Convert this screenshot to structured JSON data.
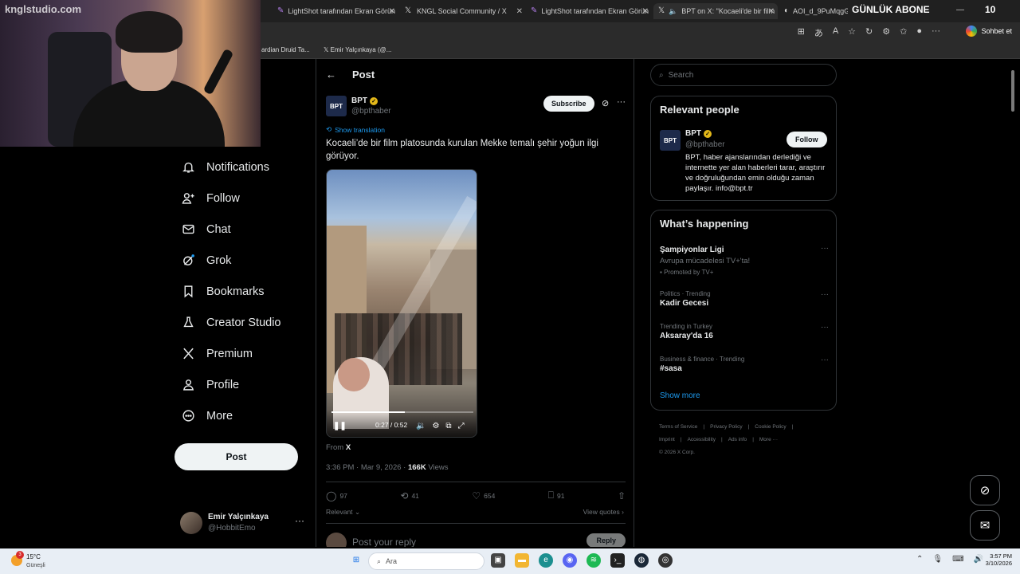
{
  "browser": {
    "tabs": [
      {
        "label": "LightShot tarafından Ekran Görün",
        "icon": "feather-icon"
      },
      {
        "label": "KNGL Social Community / X",
        "icon": "x-logo-icon"
      },
      {
        "label": "LightShot tarafından Ekran Görün",
        "icon": "feather-icon"
      },
      {
        "label": "BPT on X: \"Kocaeli'de bir film",
        "icon": "x-logo-icon",
        "active": true
      },
      {
        "label": "AOI_d_9PuMqgGU",
        "icon": "generic-icon"
      }
    ],
    "sohbet": "Sohbet et",
    "bookmarks": [
      "ardian Druid Ta...",
      "Emir Yalçınkaya (@..."
    ]
  },
  "overlay": {
    "watermark": "knglstudio.com",
    "abone_label": "GÜNLÜK ABONE",
    "abone_count": "10"
  },
  "sidebar": {
    "items": [
      {
        "label": "Notifications",
        "icon": "bell-icon"
      },
      {
        "label": "Follow",
        "icon": "follow-icon"
      },
      {
        "label": "Chat",
        "icon": "mail-icon"
      },
      {
        "label": "Grok",
        "icon": "grok-icon"
      },
      {
        "label": "Bookmarks",
        "icon": "bookmark-icon"
      },
      {
        "label": "Creator Studio",
        "icon": "flask-icon"
      },
      {
        "label": "Premium",
        "icon": "x-logo-icon"
      },
      {
        "label": "Profile",
        "icon": "person-icon"
      },
      {
        "label": "More",
        "icon": "more-circle-icon"
      }
    ],
    "post_label": "Post",
    "account_name": "Emir Yalçınkaya",
    "account_handle": "@HobbitEmo"
  },
  "post": {
    "header": "Post",
    "author_name": "BPT",
    "author_handle": "@bpthaber",
    "author_avatar_text": "BPT",
    "subscribe_label": "Subscribe",
    "show_translation": "Show translation",
    "text": "Kocaeli’de bir film platosunda kurulan Mekke temalı şehir yoğun ilgi görüyor.",
    "video": {
      "current": "0:27",
      "duration": "0:52",
      "time_text": "0:27 / 0:52",
      "progress": 0.519
    },
    "from_label": "From",
    "from_source": "X",
    "timestamp": "3:36 PM · Mar 9, 2026 ·",
    "views_count": "166K",
    "views_label": "Views",
    "stats": {
      "replies": "97",
      "reposts": "41",
      "likes": "654",
      "bookmarks": "91"
    },
    "relevant_label": "Relevant",
    "view_quotes": "View quotes",
    "reply_placeholder": "Post your reply",
    "reply_button": "Reply"
  },
  "right": {
    "search_placeholder": "Search",
    "relevant_title": "Relevant people",
    "person": {
      "name": "BPT",
      "handle": "@bpthaber",
      "avatar_text": "BPT",
      "follow_label": "Follow",
      "bio": "BPT, haber ajanslarından derlediği ve internette yer alan haberleri tarar, araştırır ve doğruluğundan emin olduğu zaman paylaşır. info@bpt.tr"
    },
    "happening_title": "What’s happening",
    "trends": [
      {
        "context": "",
        "title": "Şampiyonlar Ligi",
        "subtitle": "Avrupa mücadelesi TV+'ta!",
        "promo": "Promoted by TV+"
      },
      {
        "context": "Politics · Trending",
        "title": "Kadir Gecesi"
      },
      {
        "context": "Trending in Turkey",
        "title": "Aksaray'da 16"
      },
      {
        "context": "Business & finance · Trending",
        "title": "#sasa"
      }
    ],
    "show_more": "Show more",
    "footer": [
      "Terms of Service",
      "|",
      "Privacy Policy",
      "|",
      "Cookie Policy",
      "|",
      "Imprint",
      "|",
      "Accessibility",
      "|",
      "Ads info",
      "|",
      "More ···",
      "© 2026 X Corp."
    ]
  },
  "taskbar": {
    "temp": "15°C",
    "place": "Güneşli",
    "weather_badge": "3",
    "search_placeholder": "Ara",
    "time": "3:57 PM",
    "date": "3/10/2026"
  }
}
